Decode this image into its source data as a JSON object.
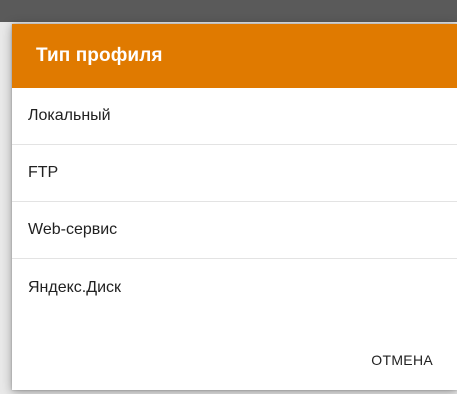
{
  "dialog": {
    "title": "Тип профиля",
    "options": [
      {
        "label": "Локальный"
      },
      {
        "label": "FTP"
      },
      {
        "label": "Web-сервис"
      },
      {
        "label": "Яндекс.Диск"
      }
    ],
    "cancel_label": "ОТМЕНА"
  },
  "colors": {
    "header": "#e07a00",
    "header_text": "#ffffff",
    "text": "#212121",
    "divider": "#e3e3e3"
  }
}
